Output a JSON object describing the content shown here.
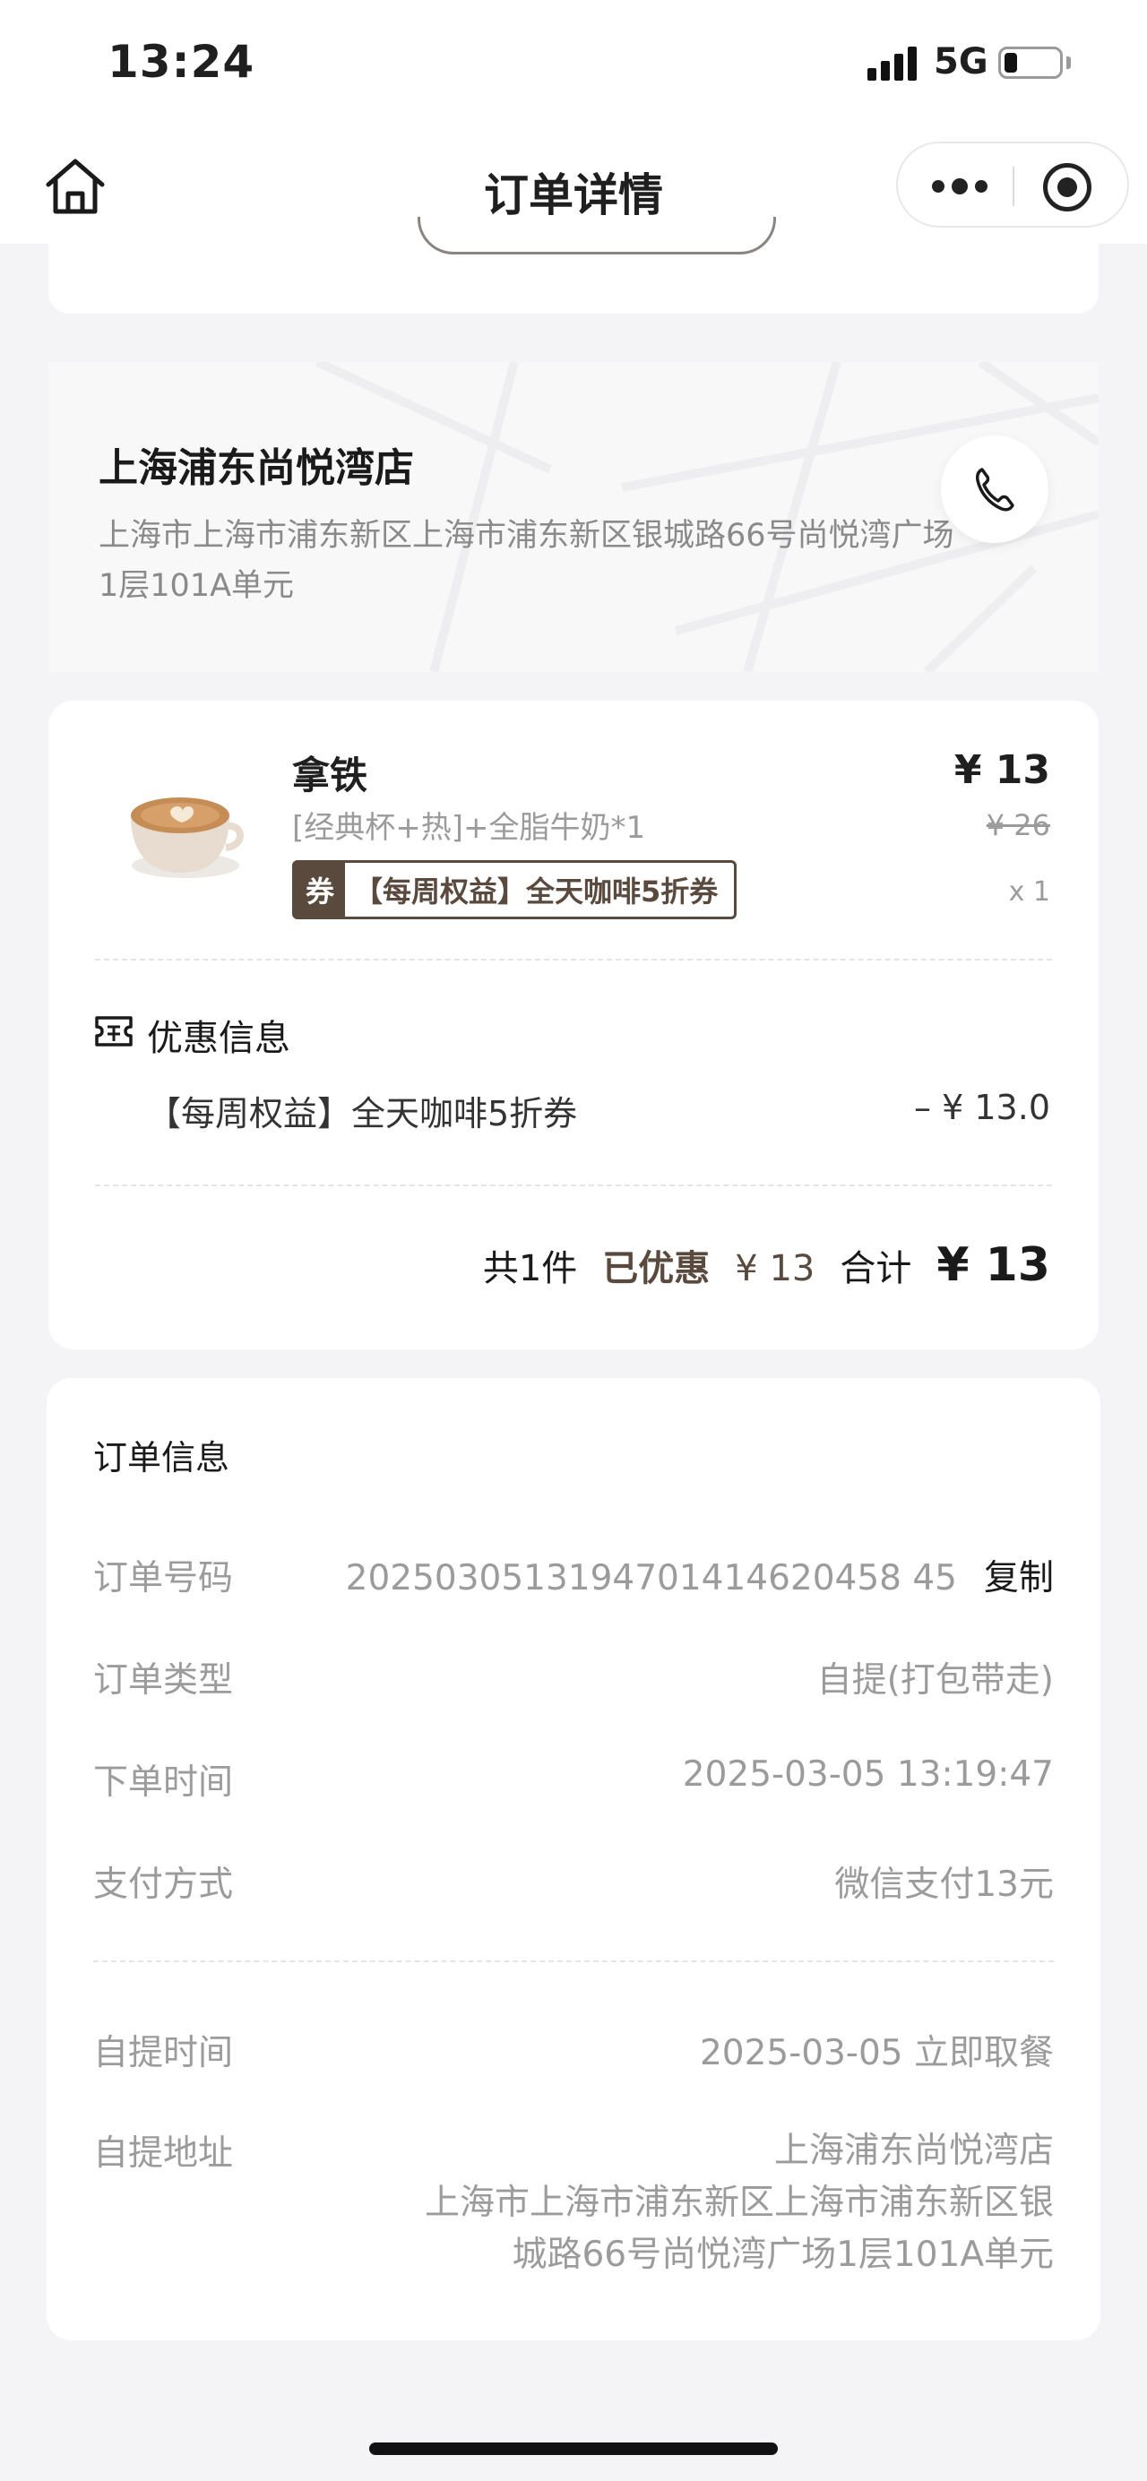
{
  "status_bar": {
    "time": "13:24",
    "network": "5G"
  },
  "nav": {
    "title": "订单详情",
    "home_icon": "home-icon",
    "more_icon": "more-dots-icon",
    "close_icon": "mini-program-close-icon"
  },
  "store": {
    "name": "上海浦东尚悦湾店",
    "address": "上海市上海市浦东新区上海市浦东新区银城路66号尚悦湾广场1层101A单元",
    "phone_icon": "phone-icon"
  },
  "order": {
    "product": {
      "name": "拿铁",
      "spec": "[经典杯+热]+全脂牛奶*1",
      "coupon_badge": "券",
      "coupon_text": "【每周权益】全天咖啡5折券",
      "price": "¥ 13",
      "original_price": "¥ 26",
      "quantity": "x 1",
      "image_icon": "latte-cup-image"
    },
    "discount": {
      "title": "优惠信息",
      "icon": "ticket-icon",
      "item_name": "【每周权益】全天咖啡5折券",
      "item_amount": "– ¥ 13.0"
    },
    "summary": {
      "count": "共1件",
      "saved_label": "已优惠",
      "saved_value": "¥ 13",
      "total_label": "合计",
      "total_value": "¥ 13"
    }
  },
  "info": {
    "title": "订单信息",
    "order_no_label": "订单号码",
    "order_no": "2025030513194701414620458 45",
    "copy_label": "复制",
    "order_type_label": "订单类型",
    "order_type": "自提(打包带走)",
    "order_time_label": "下单时间",
    "order_time": "2025-03-05 13:19:47",
    "payment_label": "支付方式",
    "payment": "微信支付13元",
    "pickup_time_label": "自提时间",
    "pickup_time": "2025-03-05 立即取餐",
    "pickup_addr_label": "自提地址",
    "pickup_addr_line1": "上海浦东尚悦湾店",
    "pickup_addr_line2": "上海市上海市浦东新区上海市浦东新区银",
    "pickup_addr_line3": "城路66号尚悦湾广场1层101A单元"
  },
  "colors": {
    "accent_brown": "#5a4a3e",
    "muted_text": "#9b9b9b",
    "background": "#f4f4f6"
  }
}
